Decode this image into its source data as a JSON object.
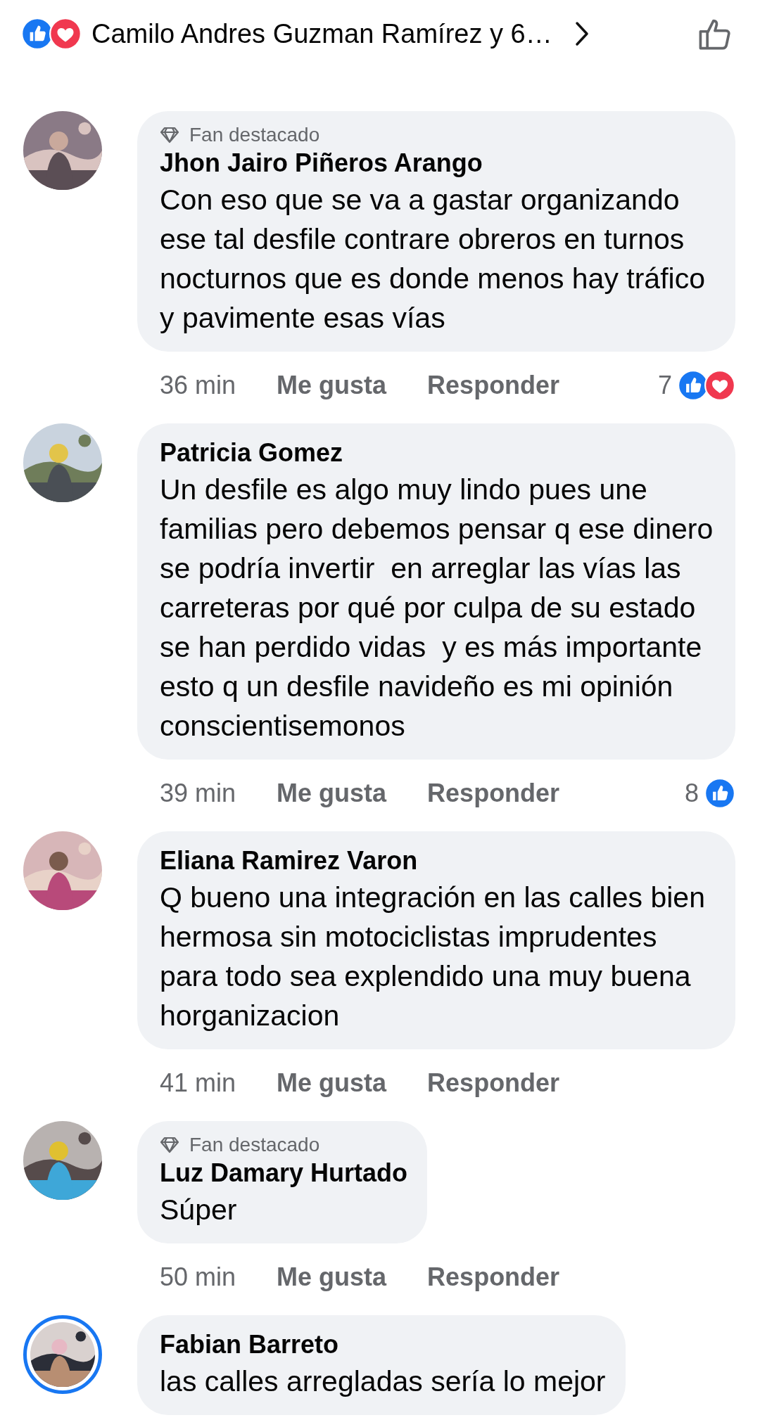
{
  "header": {
    "reactions": {
      "like": true,
      "love": true
    },
    "title": "Camilo Andres Guzman Ramírez y 6…"
  },
  "comments": [
    {
      "avatar": {
        "kind": "picture",
        "story_ring": false
      },
      "badge": "Fan destacado",
      "author": "Jhon Jairo Piñeros Arango",
      "text": "Con eso que se va a gastar organizando ese tal desfile contrare obreros en turnos nocturnos que es donde menos hay tráfico y pavimente esas vías",
      "time": "36 min",
      "like": "Me gusta",
      "reply": "Responder",
      "reaction_count": "7",
      "reactions": {
        "like": true,
        "love": true
      }
    },
    {
      "avatar": {
        "kind": "picture",
        "story_ring": false
      },
      "author": "Patricia Gomez",
      "text": "Un desfile es algo muy lindo pues une familias pero debemos pensar q ese dinero se podría invertir  en arreglar las vías las carreteras por qué por culpa de su estado se han perdido vidas  y es más importante esto q un desfile navideño es mi opinión  conscientisemonos",
      "time": "39 min",
      "like": "Me gusta",
      "reply": "Responder",
      "reaction_count": "8",
      "reactions": {
        "like": true
      }
    },
    {
      "avatar": {
        "kind": "picture",
        "story_ring": false
      },
      "author": "Eliana Ramirez Varon",
      "text": "Q bueno una integración en las calles bien hermosa sin motociclistas imprudentes  para todo sea explendido una muy buena horganizacion",
      "time": "41 min",
      "like": "Me gusta",
      "reply": "Responder"
    },
    {
      "avatar": {
        "kind": "picture",
        "story_ring": false
      },
      "badge": "Fan destacado",
      "author": "Luz Damary Hurtado",
      "text": "Súper",
      "time": "50 min",
      "like": "Me gusta",
      "reply": "Responder"
    },
    {
      "avatar": {
        "kind": "picture",
        "story_ring": true
      },
      "author": "Fabian Barreto",
      "text": "las calles arregladas sería lo mejor"
    }
  ]
}
